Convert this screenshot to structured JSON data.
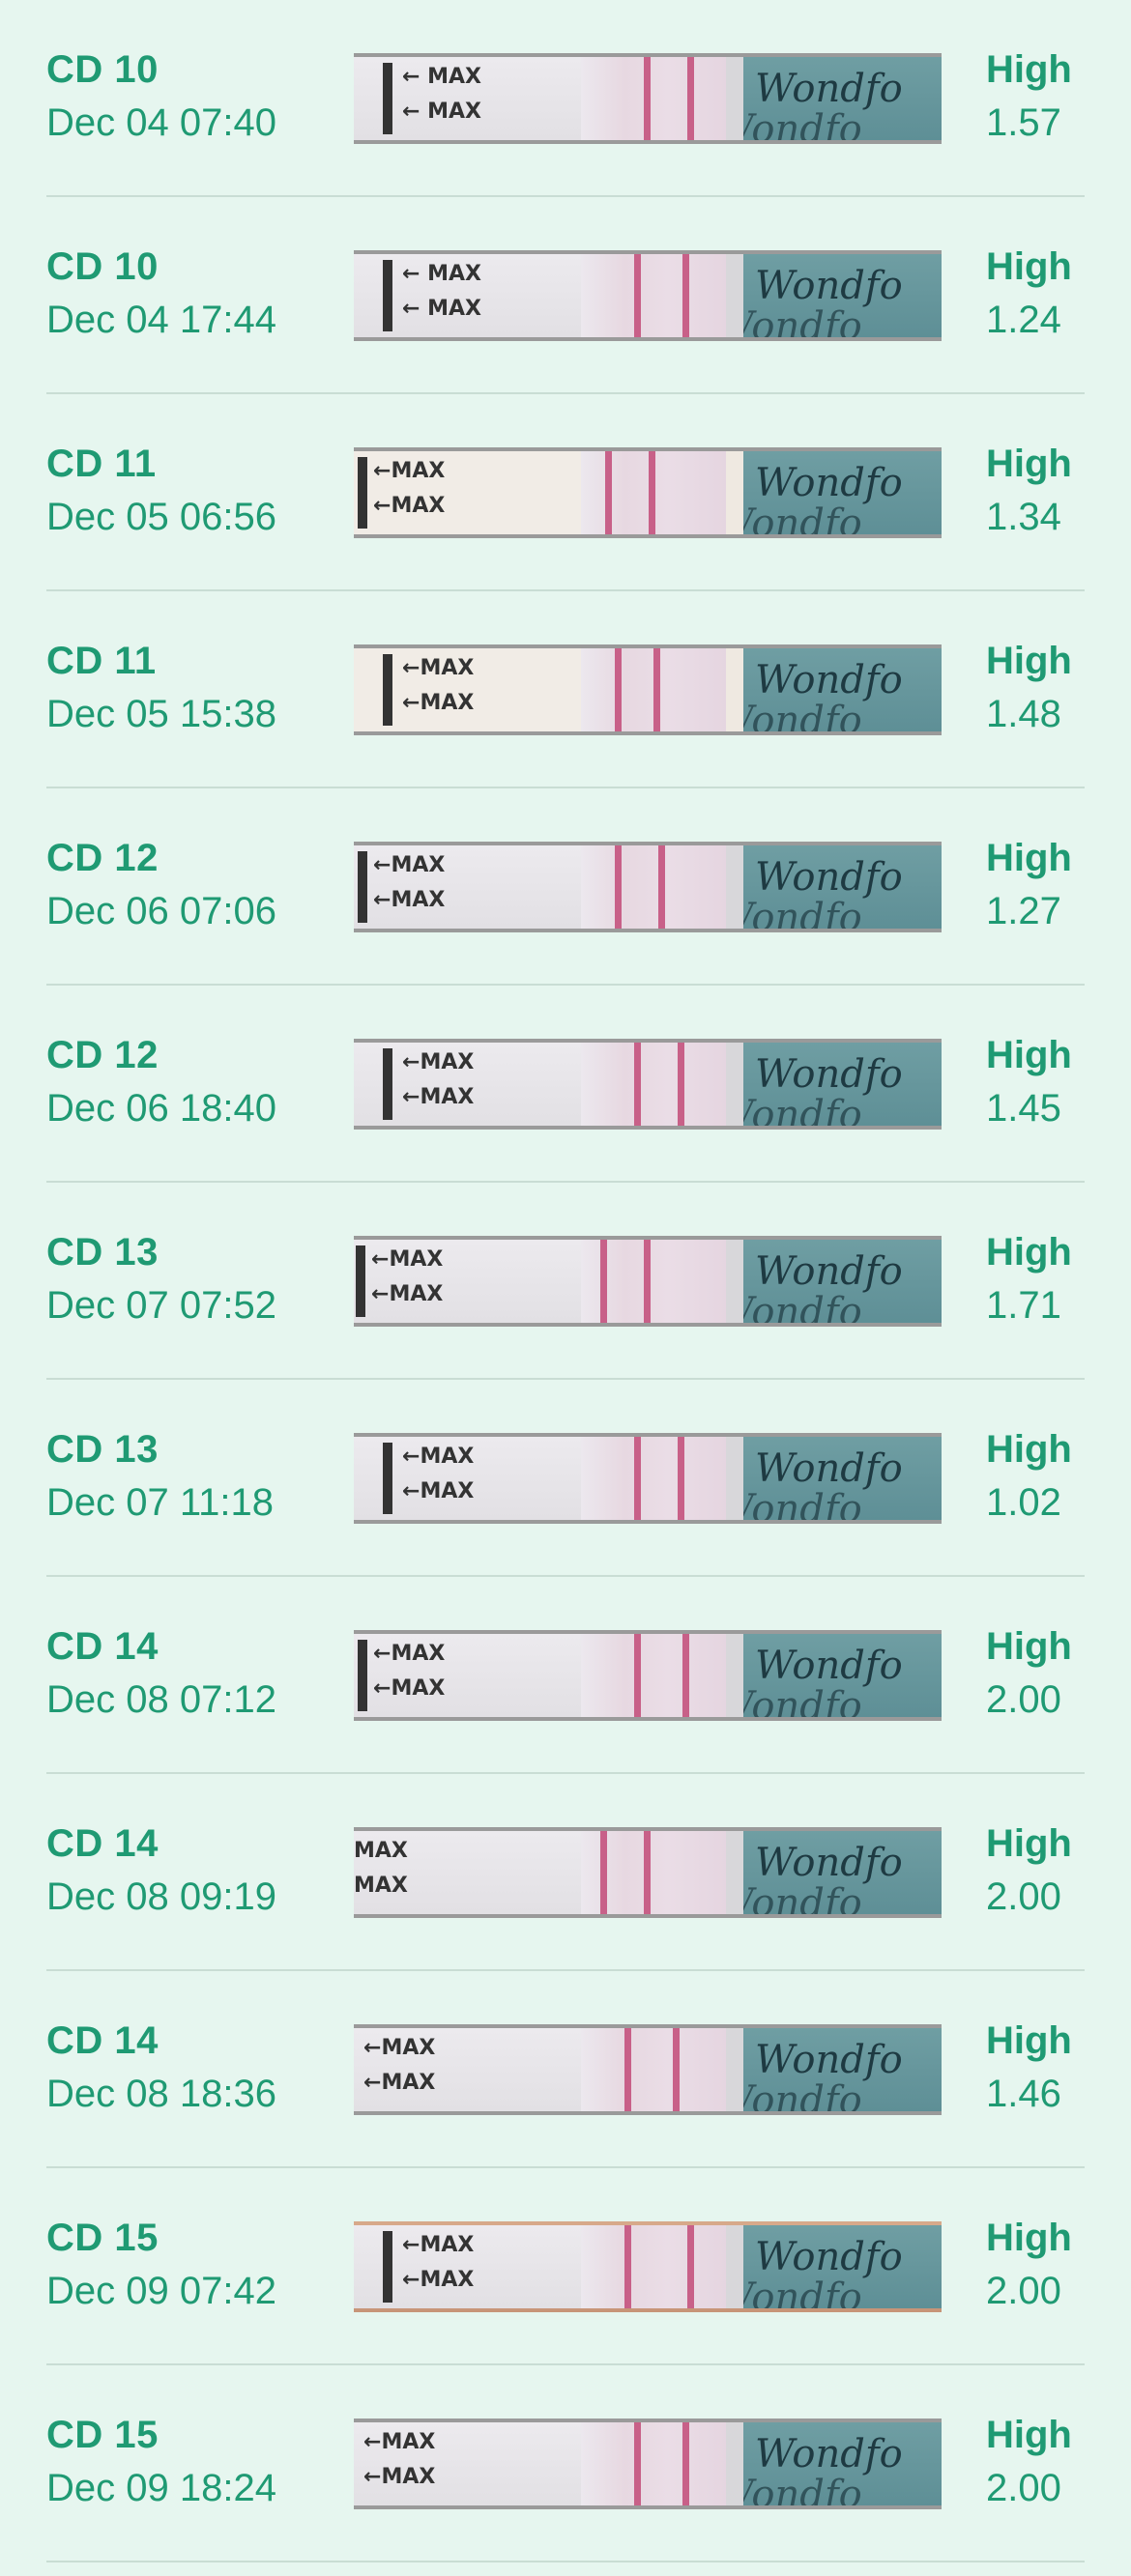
{
  "brand_text": "Wondfo",
  "max_text": "MAX",
  "colors": {
    "background": "#e6f6ef",
    "text": "#1f9a73",
    "divider": "#c9ddd4",
    "test_line": "#c24a78",
    "strip_brand": "#6f9ea3"
  },
  "rows": [
    {
      "cd": "CD 10",
      "date": "Dec 04 07:40",
      "level": "High",
      "ratio": "1.57"
    },
    {
      "cd": "CD 10",
      "date": "Dec 04 17:44",
      "level": "High",
      "ratio": "1.24"
    },
    {
      "cd": "CD 11",
      "date": "Dec 05 06:56",
      "level": "High",
      "ratio": "1.34"
    },
    {
      "cd": "CD 11",
      "date": "Dec 05 15:38",
      "level": "High",
      "ratio": "1.48"
    },
    {
      "cd": "CD 12",
      "date": "Dec 06 07:06",
      "level": "High",
      "ratio": "1.27"
    },
    {
      "cd": "CD 12",
      "date": "Dec 06 18:40",
      "level": "High",
      "ratio": "1.45"
    },
    {
      "cd": "CD 13",
      "date": "Dec 07 07:52",
      "level": "High",
      "ratio": "1.71"
    },
    {
      "cd": "CD 13",
      "date": "Dec 07 11:18",
      "level": "High",
      "ratio": "1.02"
    },
    {
      "cd": "CD 14",
      "date": "Dec 08 07:12",
      "level": "High",
      "ratio": "2.00"
    },
    {
      "cd": "CD 14",
      "date": "Dec 08 09:19",
      "level": "High",
      "ratio": "2.00"
    },
    {
      "cd": "CD 14",
      "date": "Dec 08 18:36",
      "level": "High",
      "ratio": "1.46"
    },
    {
      "cd": "CD 15",
      "date": "Dec 09 07:42",
      "level": "High",
      "ratio": "2.00"
    },
    {
      "cd": "CD 15",
      "date": "Dec 09 18:24",
      "level": "High",
      "ratio": "2.00"
    }
  ]
}
